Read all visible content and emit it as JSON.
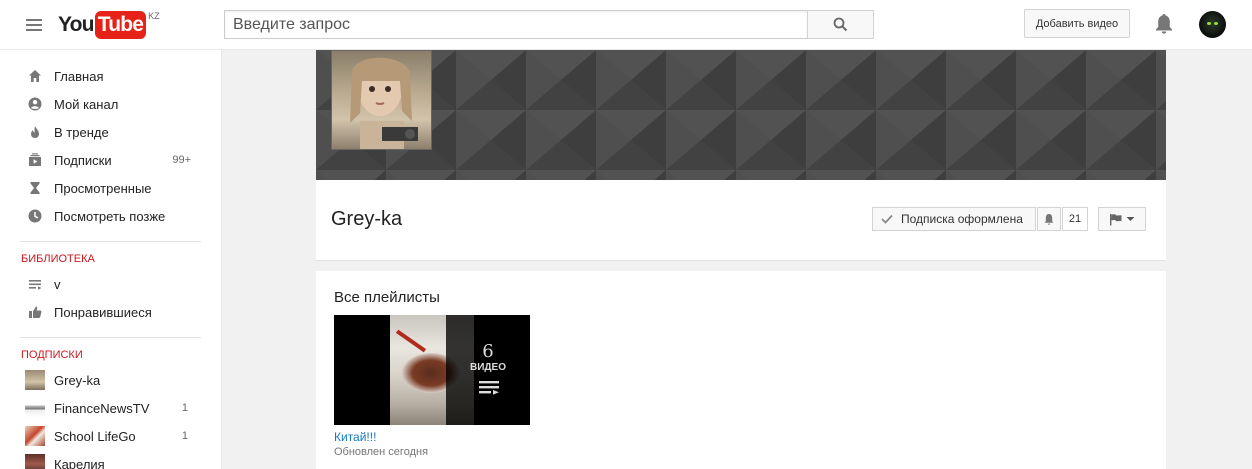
{
  "masthead": {
    "logo": {
      "you": "You",
      "tube": "Tube",
      "country": "KZ"
    },
    "search": {
      "placeholder": "Введите запрос",
      "icon": "search-icon"
    },
    "upload_label": "Добавить видео",
    "icons": [
      "menu-icon",
      "bell-icon",
      "account-avatar"
    ]
  },
  "sidebar": {
    "nav": [
      {
        "label": "Главная",
        "icon": "home-icon",
        "count": ""
      },
      {
        "label": "Мой канал",
        "icon": "account-icon",
        "count": ""
      },
      {
        "label": "В тренде",
        "icon": "flame-icon",
        "count": ""
      },
      {
        "label": "Подписки",
        "icon": "subscriptions-icon",
        "count": "99+"
      },
      {
        "label": "Просмотренные",
        "icon": "hourglass-icon",
        "count": ""
      },
      {
        "label": "Посмотреть позже",
        "icon": "clock-icon",
        "count": ""
      }
    ],
    "library_title": "БИБЛИОТЕКА",
    "library": [
      {
        "label": "v",
        "icon": "playlist-icon"
      },
      {
        "label": "Понравившиеся",
        "icon": "thumbs-up-icon"
      }
    ],
    "subscriptions_title": "ПОДПИСКИ",
    "subscriptions": [
      {
        "label": "Grey-ka",
        "count": ""
      },
      {
        "label": "FinanceNewsTV",
        "count": "1"
      },
      {
        "label": "School LifeGo",
        "count": "1"
      },
      {
        "label": "Карелия",
        "count": ""
      }
    ]
  },
  "channel": {
    "name": "Grey-ka",
    "subscribe_label": "Подписка оформлена",
    "subscriber_count": "21"
  },
  "content": {
    "section_title": "Все плейлисты",
    "playlists": [
      {
        "title": "Китай!!!",
        "video_count": "6",
        "video_label": "ВИДЕО",
        "meta": "Обновлен сегодня"
      }
    ]
  },
  "colors": {
    "brand_red": "#e62117",
    "section_red": "#cc181e",
    "link_blue": "#167ac6",
    "banner_bg": "#474747",
    "page_bg": "#f1f1f1"
  }
}
